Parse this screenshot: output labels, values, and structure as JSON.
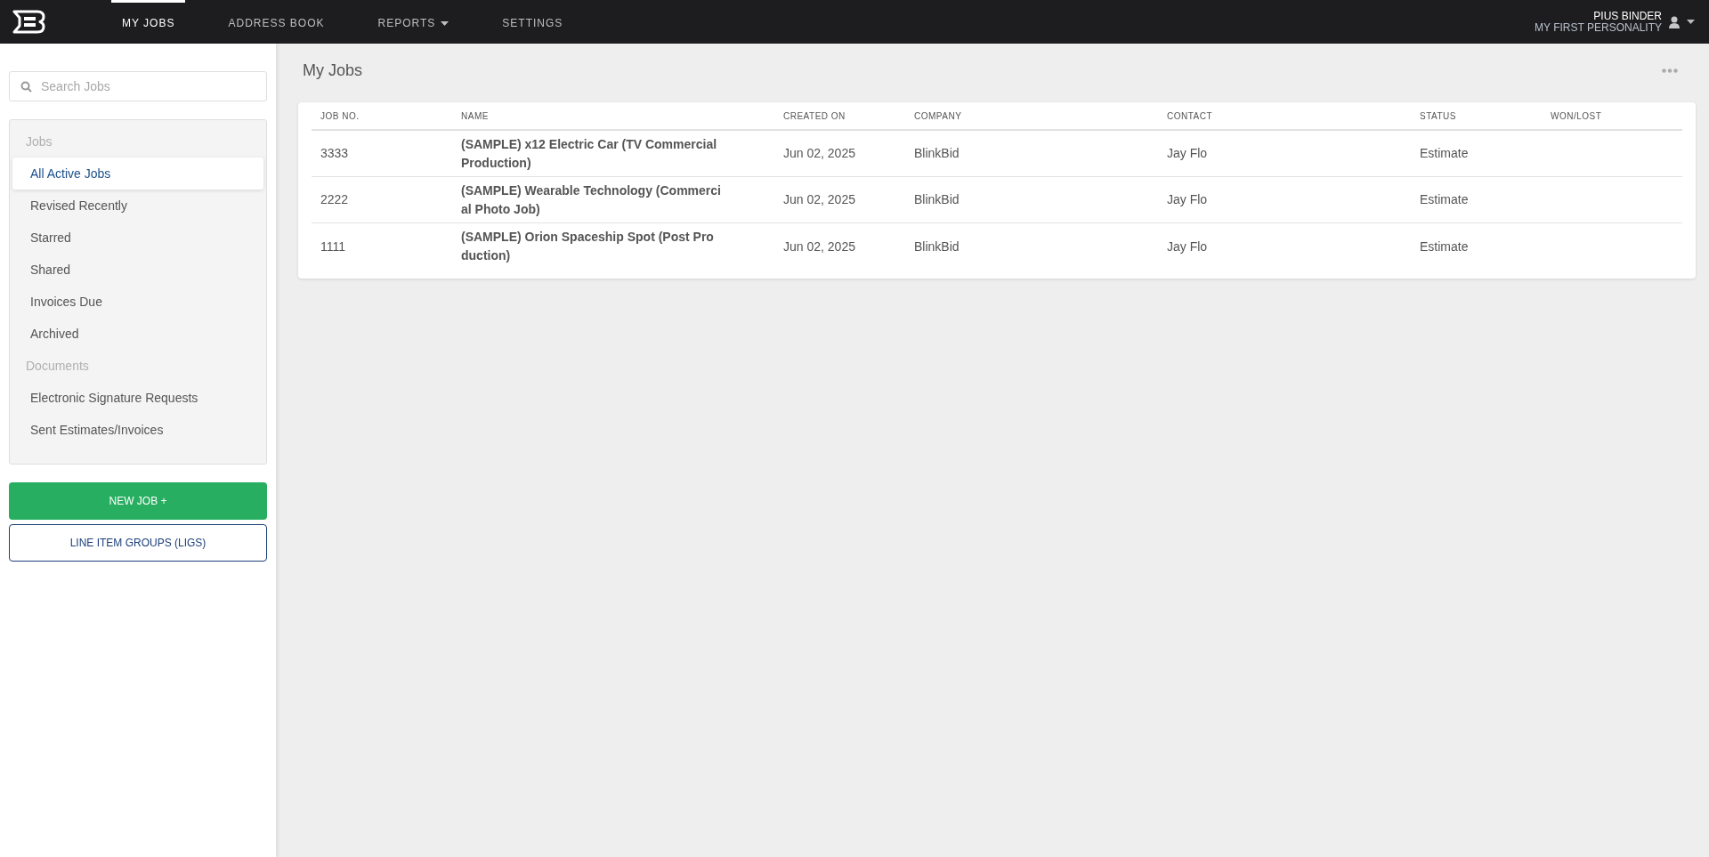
{
  "nav": {
    "items": [
      {
        "label": "MY JOBS",
        "selected": true,
        "dropdown": false
      },
      {
        "label": "ADDRESS BOOK",
        "selected": false,
        "dropdown": false
      },
      {
        "label": "REPORTS",
        "selected": false,
        "dropdown": true
      },
      {
        "label": "SETTINGS",
        "selected": false,
        "dropdown": false
      }
    ],
    "user": {
      "name": "PIUS BINDER",
      "personality": "MY FIRST PERSONALITY"
    }
  },
  "sidebar": {
    "search": {
      "placeholder": "Search Jobs"
    },
    "items": [
      {
        "kind": "heading",
        "label": "Jobs"
      },
      {
        "kind": "link",
        "label": "All Active Jobs",
        "selected": true
      },
      {
        "kind": "link",
        "label": "Revised Recently",
        "selected": false
      },
      {
        "kind": "link",
        "label": "Starred",
        "selected": false
      },
      {
        "kind": "link",
        "label": "Shared",
        "selected": false
      },
      {
        "kind": "link",
        "label": "Invoices Due",
        "selected": false
      },
      {
        "kind": "link",
        "label": "Archived",
        "selected": false
      },
      {
        "kind": "heading",
        "label": "Documents"
      },
      {
        "kind": "link",
        "label": "Electronic Signature Requests",
        "selected": false
      },
      {
        "kind": "link",
        "label": "Sent Estimates/Invoices",
        "selected": false
      }
    ],
    "buttons": [
      {
        "kind": "primary",
        "label": "NEW JOB +"
      },
      {
        "kind": "outline",
        "label": "LINE ITEM GROUPS (LIGS)"
      }
    ]
  },
  "main": {
    "title": "My Jobs",
    "table": {
      "columns": [
        "JOB NO.",
        "NAME",
        "CREATED ON",
        "COMPANY",
        "CONTACT",
        "STATUS",
        "WON/LOST"
      ],
      "rows": [
        [
          "3333",
          "(SAMPLE) x12 Electric Car (TV Commercial Production)",
          "Jun 02, 2025",
          "BlinkBid",
          "Jay Flo",
          "Estimate",
          ""
        ],
        [
          "2222",
          "(SAMPLE) Wearable Technology (Commercial Photo Job)",
          "Jun 02, 2025",
          "BlinkBid",
          "Jay Flo",
          "Estimate",
          ""
        ],
        [
          "1111",
          "(SAMPLE) Orion Spaceship Spot (Post Production)",
          "Jun 02, 2025",
          "BlinkBid",
          "Jay Flo",
          "Estimate",
          ""
        ]
      ]
    }
  }
}
